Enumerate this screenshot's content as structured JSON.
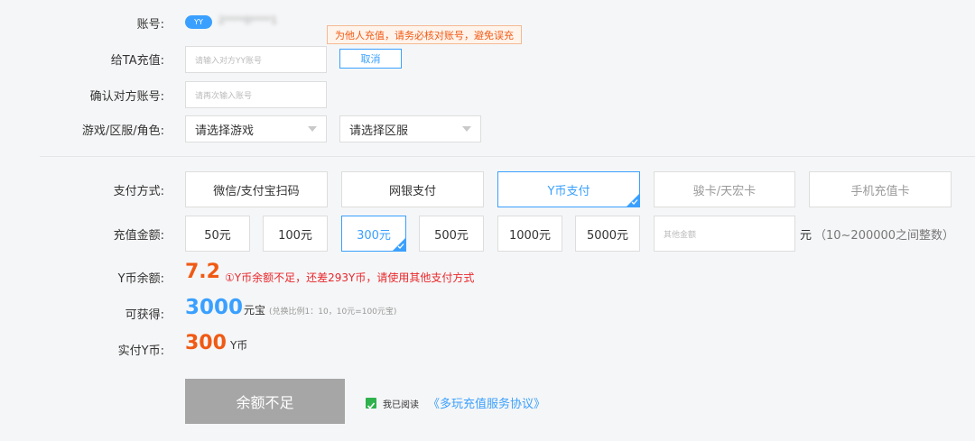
{
  "account": {
    "label": "账号:",
    "badge_text": "YY",
    "username_blurred": "2****0****1"
  },
  "warning_tip": "为他人充值，请务必核对账号，避免误充",
  "recharge_for": {
    "label": "给TA充值:",
    "placeholder": "请输入对方YY账号",
    "cancel_label": "取消"
  },
  "confirm_account": {
    "label": "确认对方账号:",
    "placeholder": "请再次输入账号"
  },
  "game_region": {
    "label": "游戏/区服/角色:",
    "game_select": "请选择游戏",
    "server_select": "请选择区服"
  },
  "payment": {
    "label": "支付方式:",
    "methods": [
      "微信/支付宝扫码",
      "网银支付",
      "Y币支付",
      "骏卡/天宏卡",
      "手机充值卡"
    ],
    "selected": "Y币支付"
  },
  "amount": {
    "label": "充值金额:",
    "options": [
      "50元",
      "100元",
      "300元",
      "500元",
      "1000元",
      "5000元"
    ],
    "selected": "300元",
    "other_placeholder": "其他金额",
    "unit": "元",
    "range_hint": "（10~200000之间整数）"
  },
  "balance": {
    "label": "Y币余额:",
    "value": "7.2",
    "warning": "①Y币余额不足，还差293Y币，请使用其他支付方式"
  },
  "obtain": {
    "label": "可获得:",
    "value": "3000",
    "unit": "元宝",
    "ratio": "(兑换比例1：10，10元=100元宝)"
  },
  "pay_actual": {
    "label": "实付Y币:",
    "value": "300",
    "unit": "Y币"
  },
  "submit_label": "余额不足",
  "agreement": {
    "read_text": "我已阅读",
    "link_text": "《多玩充值服务协议》"
  },
  "colors": {
    "accent_blue": "#3aa0ff",
    "orange": "#f05a14",
    "red": "#e8282d",
    "disabled_button": "#a6a6a6",
    "checkbox_green": "#2fb24d"
  }
}
